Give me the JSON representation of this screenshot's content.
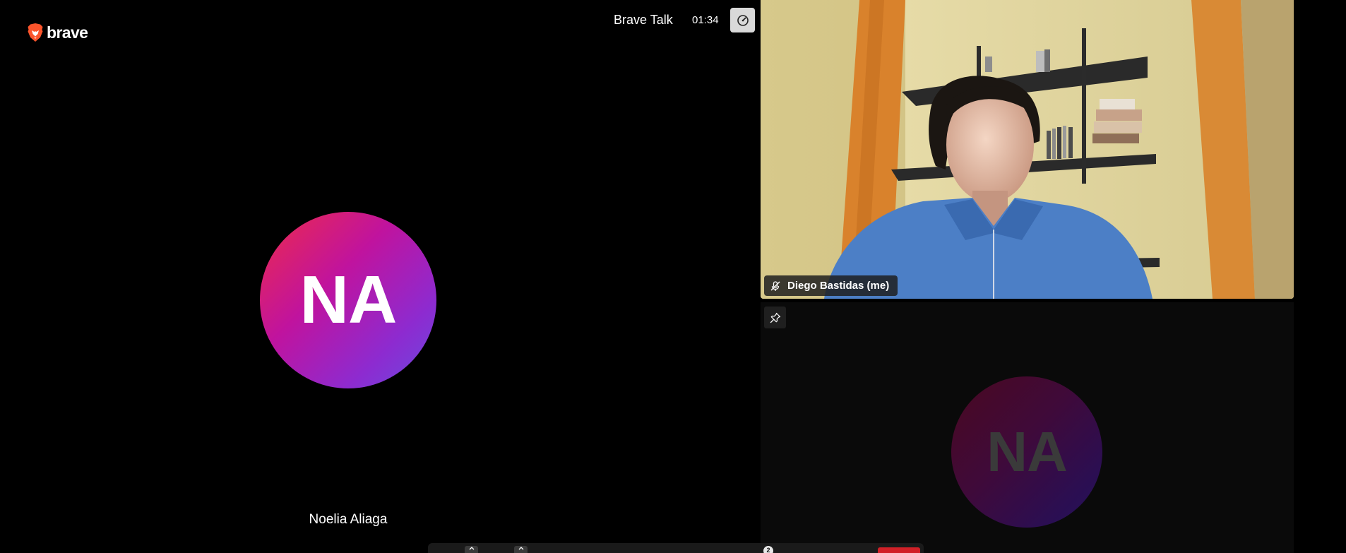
{
  "brand": {
    "name": "brave"
  },
  "header": {
    "title": "Brave Talk",
    "timer": "01:34",
    "performance_icon": "gauge-icon"
  },
  "stage": {
    "participant_initials": "NA",
    "participant_name": "Noelia Aliaga"
  },
  "filmstrip": {
    "self_tile": {
      "name": "Diego Bastidas (me)",
      "muted_icon": "mic-muted-icon"
    },
    "remote_tile": {
      "initials": "NA",
      "pin_icon": "pin-icon"
    }
  },
  "toolbar": {
    "participants_badge": "2"
  },
  "colors": {
    "background": "#000000",
    "avatar_gradient_start": "#ee2b4a",
    "avatar_gradient_end": "#6a4be0",
    "hangup": "#d12027"
  }
}
